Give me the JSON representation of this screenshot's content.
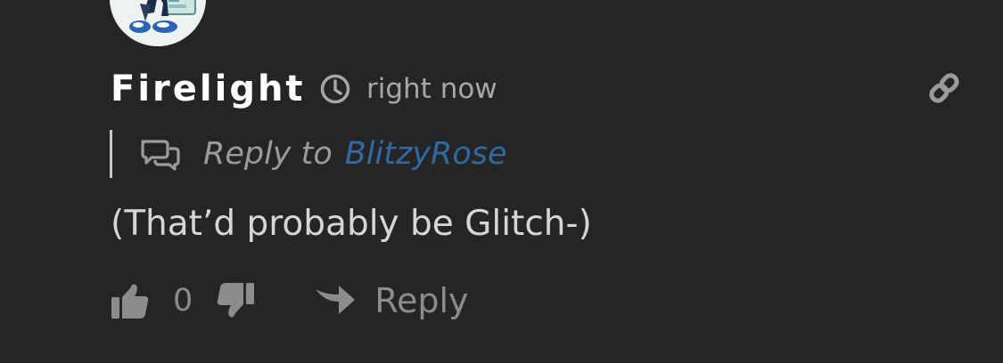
{
  "comment": {
    "author": "Firelight",
    "timestamp": "right now",
    "reply_prefix": "Reply to",
    "reply_target": "BlitzyRose",
    "text": "(That’d probably be Glitch-)",
    "vote_count": "0",
    "reply_label": "Reply"
  },
  "icons": {
    "avatar": "avatar",
    "timestamp": "clock-icon",
    "permalink": "link-icon",
    "reply_to": "speech-bubbles-icon",
    "upvote": "thumbs-up-icon",
    "downvote": "thumbs-down-icon",
    "reply": "share-arrow-icon"
  },
  "colors": {
    "background": "#252525",
    "author": "#ffffff",
    "meta": "#a7a7a7",
    "link": "#2f6aa5",
    "text": "#d6d6d6",
    "muted": "#8c8c8c"
  }
}
